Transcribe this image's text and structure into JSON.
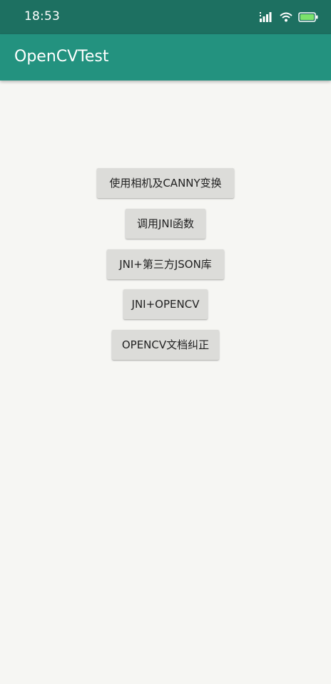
{
  "status_bar": {
    "time": "18:53",
    "icons": [
      "signal-icon",
      "wifi-icon",
      "battery-icon"
    ]
  },
  "app_bar": {
    "title": "OpenCVTest"
  },
  "buttons": [
    {
      "label": "使用相机及CANNY变换"
    },
    {
      "label": "调用JNI函数"
    },
    {
      "label": "JNI+第三方JSON库"
    },
    {
      "label": "JNI+OPENCV"
    },
    {
      "label": "OPENCV文档纠正"
    }
  ],
  "colors": {
    "status_bar": "#1d7061",
    "app_bar": "#23927f",
    "background": "#f6f6f3",
    "button": "#dcdcd9"
  }
}
